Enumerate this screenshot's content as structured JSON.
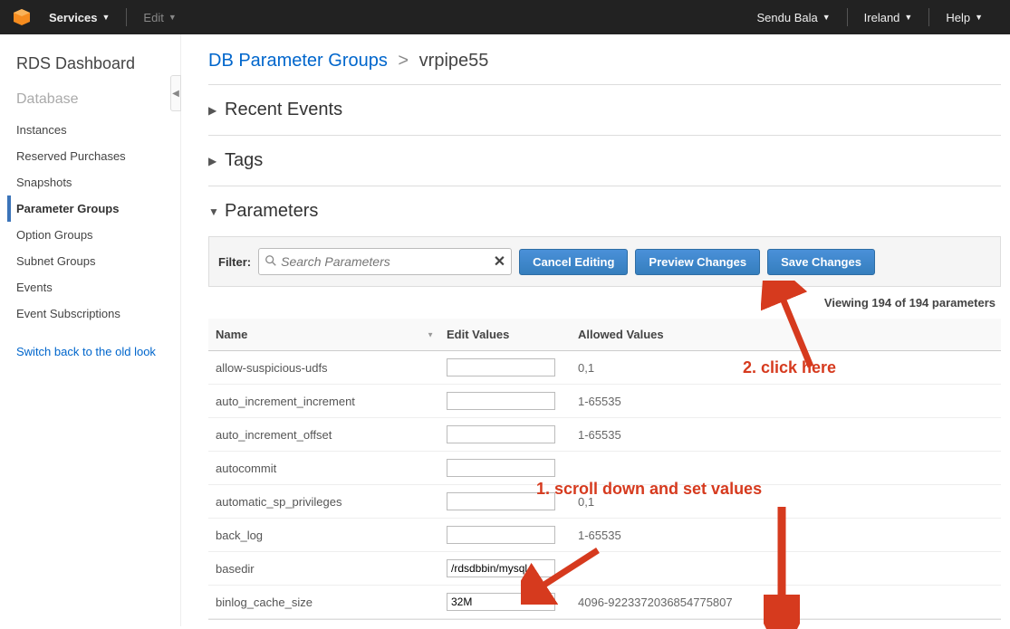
{
  "topnav": {
    "services": "Services",
    "edit": "Edit",
    "user": "Sendu Bala",
    "region": "Ireland",
    "help": "Help"
  },
  "sidebar": {
    "title": "RDS Dashboard",
    "section": "Database",
    "items": [
      {
        "label": "Instances"
      },
      {
        "label": "Reserved Purchases"
      },
      {
        "label": "Snapshots"
      },
      {
        "label": "Parameter Groups",
        "active": true
      },
      {
        "label": "Option Groups"
      },
      {
        "label": "Subnet Groups"
      },
      {
        "label": "Events"
      },
      {
        "label": "Event Subscriptions"
      }
    ],
    "old_look": "Switch back to the old look"
  },
  "breadcrumb": {
    "parent": "DB Parameter Groups",
    "current": "vrpipe55"
  },
  "sections": {
    "recent_events": "Recent Events",
    "tags": "Tags",
    "parameters": "Parameters"
  },
  "filter": {
    "label": "Filter:",
    "placeholder": "Search Parameters",
    "cancel": "Cancel Editing",
    "preview": "Preview Changes",
    "save": "Save Changes"
  },
  "viewing": "Viewing 194 of 194 parameters",
  "table": {
    "headers": {
      "name": "Name",
      "edit": "Edit Values",
      "allowed": "Allowed Values"
    },
    "rows": [
      {
        "name": "allow-suspicious-udfs",
        "value": "",
        "allowed": "0,1"
      },
      {
        "name": "auto_increment_increment",
        "value": "",
        "allowed": "1-65535"
      },
      {
        "name": "auto_increment_offset",
        "value": "",
        "allowed": "1-65535"
      },
      {
        "name": "autocommit",
        "value": "",
        "allowed": ""
      },
      {
        "name": "automatic_sp_privileges",
        "value": "",
        "allowed": "0,1"
      },
      {
        "name": "back_log",
        "value": "",
        "allowed": "1-65535"
      },
      {
        "name": "basedir",
        "value": "/rdsdbbin/mysql",
        "allowed": ""
      },
      {
        "name": "binlog_cache_size",
        "value": "32M",
        "allowed": "4096-9223372036854775807"
      }
    ]
  },
  "annotations": {
    "scroll": "1. scroll down and set values",
    "click": "2. click here"
  }
}
